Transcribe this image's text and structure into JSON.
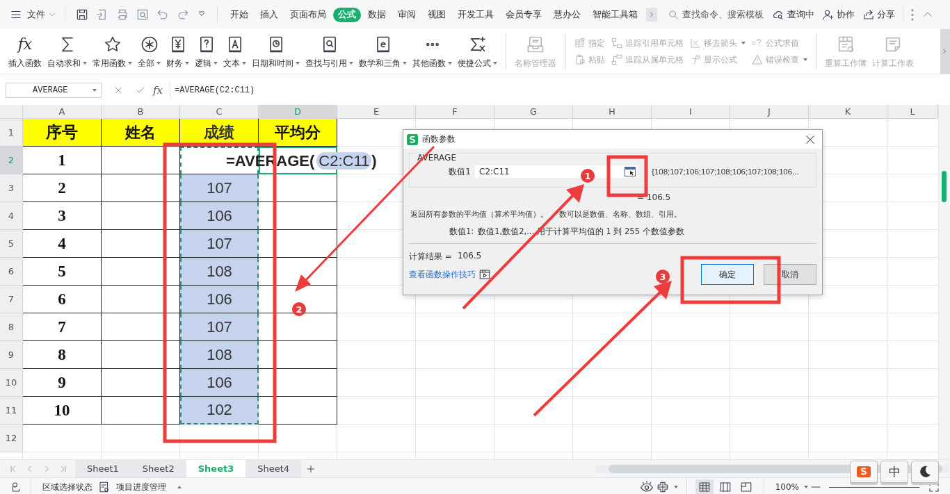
{
  "menu": {
    "file": "文件",
    "tabs": [
      {
        "label": "开始",
        "selected": false
      },
      {
        "label": "插入",
        "selected": false
      },
      {
        "label": "页面布局",
        "selected": false
      },
      {
        "label": "公式",
        "selected": true
      },
      {
        "label": "数据",
        "selected": false
      },
      {
        "label": "审阅",
        "selected": false
      },
      {
        "label": "视图",
        "selected": false
      },
      {
        "label": "开发工具",
        "selected": false
      },
      {
        "label": "会员专享",
        "selected": false
      },
      {
        "label": "慧办公",
        "selected": false
      },
      {
        "label": "智能工具箱",
        "selected": false
      }
    ],
    "search": {
      "placeholder": "查找命令、搜索模板"
    },
    "actions": [
      "查询中",
      "协作",
      "分享"
    ]
  },
  "ribbon": {
    "items": [
      {
        "label": "插入函数",
        "glyph": "fx",
        "dropdown": false
      },
      {
        "label": "自动求和",
        "dropdown": true
      },
      {
        "label": "常用函数",
        "dropdown": true
      },
      {
        "label": "全部",
        "dropdown": true
      },
      {
        "label": "财务",
        "dropdown": true
      },
      {
        "label": "逻辑",
        "dropdown": true
      },
      {
        "label": "文本",
        "dropdown": true
      },
      {
        "label": "日期和时间",
        "dropdown": true
      },
      {
        "label": "查找与引用",
        "dropdown": true
      },
      {
        "label": "数学和三角",
        "dropdown": true
      },
      {
        "label": "其他函数",
        "dropdown": true
      },
      {
        "label": "便捷公式",
        "dropdown": true
      }
    ],
    "tools": [
      {
        "kind": "large",
        "label": "名称管理器",
        "disabled": true
      },
      {
        "kind": "stack",
        "items": [
          {
            "label": "指定",
            "dropdown": false,
            "disabled": true
          },
          {
            "label": "粘贴",
            "dropdown": false,
            "disabled": true
          }
        ]
      },
      {
        "kind": "stack",
        "items": [
          {
            "label": "追踪引用单元格",
            "dropdown": false,
            "disabled": true
          },
          {
            "label": "追踪从属单元格",
            "dropdown": false,
            "disabled": true
          }
        ]
      },
      {
        "kind": "stack",
        "items": [
          {
            "label": "移去箭头",
            "dropdown": true,
            "disabled": true
          },
          {
            "label": "显示公式",
            "dropdown": false,
            "disabled": true
          }
        ]
      },
      {
        "kind": "stack",
        "items": [
          {
            "label": "公式求值",
            "dropdown": false,
            "disabled": true
          },
          {
            "label": "错误检查",
            "dropdown": true,
            "disabled": true
          }
        ]
      },
      {
        "kind": "large",
        "label": "重算工作簿",
        "disabled": true
      },
      {
        "kind": "large",
        "label": "计算工作表",
        "disabled": true
      }
    ]
  },
  "formula_bar": {
    "name_box": "AVERAGE",
    "fx": "fx",
    "formula": "=AVERAGE(C2:C11)"
  },
  "grid": {
    "columns": [
      {
        "label": "A",
        "selected": false
      },
      {
        "label": "B",
        "selected": false
      },
      {
        "label": "C",
        "selected": false
      },
      {
        "label": "D",
        "selected": true
      },
      {
        "label": "E",
        "selected": false
      },
      {
        "label": "F",
        "selected": false
      },
      {
        "label": "G",
        "selected": false
      },
      {
        "label": "H",
        "selected": false
      },
      {
        "label": "I",
        "selected": false
      },
      {
        "label": "J",
        "selected": false
      },
      {
        "label": "K",
        "selected": false
      },
      {
        "label": "L",
        "selected": false
      }
    ],
    "editing": {
      "prefix": "=AVERAGE(",
      "ref": "C2:C11",
      "suffix": ")"
    },
    "rows": [
      {
        "label": "1",
        "selected": false,
        "kind": "header",
        "cells": [
          "序号",
          "姓名",
          "成绩",
          "平均分"
        ]
      },
      {
        "label": "2",
        "selected": true,
        "kind": "edit",
        "serial": "1"
      },
      {
        "label": "3",
        "selected": false,
        "kind": "data",
        "serial": "2",
        "score": "107"
      },
      {
        "label": "4",
        "selected": false,
        "kind": "data",
        "serial": "3",
        "score": "106"
      },
      {
        "label": "5",
        "selected": false,
        "kind": "data",
        "serial": "4",
        "score": "107"
      },
      {
        "label": "6",
        "selected": false,
        "kind": "data",
        "serial": "5",
        "score": "108"
      },
      {
        "label": "7",
        "selected": false,
        "kind": "data",
        "serial": "6",
        "score": "106"
      },
      {
        "label": "8",
        "selected": false,
        "kind": "data",
        "serial": "7",
        "score": "107"
      },
      {
        "label": "9",
        "selected": false,
        "kind": "data",
        "serial": "8",
        "score": "108"
      },
      {
        "label": "10",
        "selected": false,
        "kind": "data",
        "serial": "9",
        "score": "106"
      },
      {
        "label": "11",
        "selected": false,
        "kind": "data",
        "serial": "10",
        "score": "102"
      },
      {
        "label": "12",
        "selected": false,
        "kind": "empty"
      }
    ]
  },
  "dialog": {
    "title": "函数参数",
    "function_name": "AVERAGE",
    "arg_label": "数值1",
    "arg_value": "C2:C11",
    "arg_preview": "{108;107;106;107;108;106;107;108;106...",
    "arg_result": "= 106.5",
    "description": [
      "返回所有参数的平均值（算术平均值）。",
      "数可以是数值、名称、数组、引用。"
    ],
    "help_label": "数值1:",
    "help_text": "数值1,数值2,... 用于计算平均值的 1 到 255 个数值参数",
    "result_label": "计算结果 =",
    "result": "106.5",
    "link": "查看函数操作技巧",
    "buttons": [
      {
        "label": "确定",
        "selected": true
      },
      {
        "label": "取消",
        "selected": false
      }
    ]
  },
  "sheets": [
    {
      "label": "Sheet1",
      "selected": false
    },
    {
      "label": "Sheet2",
      "selected": false
    },
    {
      "label": "Sheet3",
      "selected": true
    },
    {
      "label": "Sheet4",
      "selected": false
    }
  ],
  "status_bar": {
    "left": [
      "区域选择状态",
      "项目进度管理"
    ],
    "views": [
      {
        "selected": true
      },
      {
        "selected": false
      },
      {
        "selected": false
      }
    ],
    "zoom": "100%"
  },
  "ime": {
    "label": "中"
  },
  "annotations": {
    "badges": [
      "1",
      "2",
      "3"
    ]
  }
}
